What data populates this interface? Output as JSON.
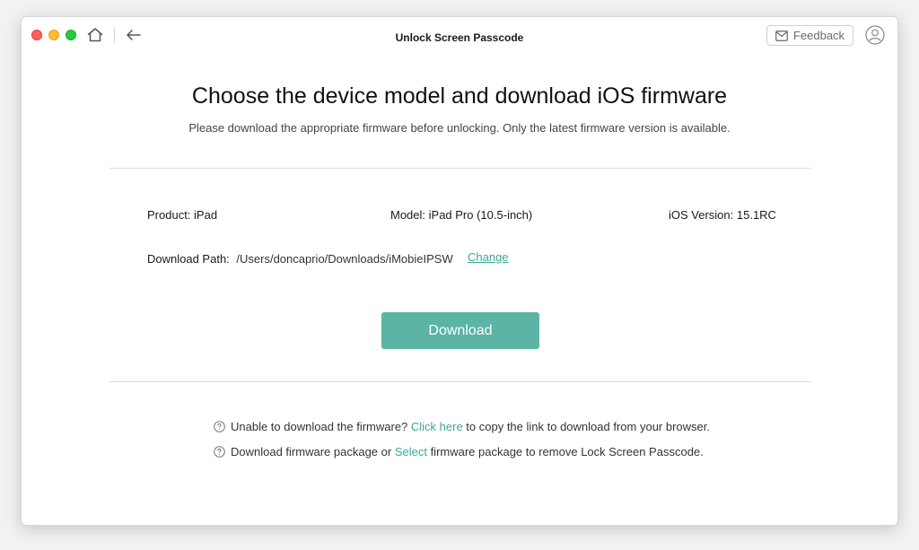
{
  "window": {
    "title": "Unlock Screen Passcode",
    "feedback_label": "Feedback"
  },
  "main": {
    "heading": "Choose the device model and download iOS firmware",
    "subheading": "Please download the appropriate firmware before unlocking. Only the latest firmware version is available.",
    "product": "Product: iPad",
    "model": "Model: iPad Pro (10.5-inch)",
    "ios_version": "iOS Version: 15.1RC",
    "download_path_label": "Download Path:",
    "download_path_value": "/Users/doncaprio/Downloads/iMobieIPSW",
    "change_label": "Change",
    "download_label": "Download"
  },
  "help": {
    "line1_pre": "Unable to download the firmware? ",
    "line1_link": "Click here",
    "line1_post": " to copy the link to download from your browser.",
    "line2_pre": "Download firmware package or ",
    "line2_link": "Select",
    "line2_post": " firmware package to remove Lock Screen Passcode."
  },
  "colors": {
    "accent": "#5bb4a4",
    "link": "#3ca895",
    "close": "#fe5f57",
    "minimize": "#febc2e",
    "maximize": "#28c840"
  },
  "icons": {
    "home": "home-icon",
    "back": "arrow-left-icon",
    "feedback": "mail-icon",
    "account": "user-icon",
    "help": "question-circle-icon"
  }
}
